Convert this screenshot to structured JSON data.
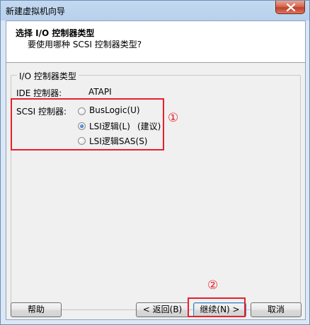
{
  "window": {
    "title": "新建虚拟机向导"
  },
  "header": {
    "title": "选择 I/O 控制器类型",
    "subtitle": "要使用哪种 SCSI 控制器类型?"
  },
  "group": {
    "legend": "I/O 控制器类型",
    "ide_label": "IDE 控制器:",
    "ide_value": "ATAPI",
    "scsi_label": "SCSI 控制器:",
    "options": [
      {
        "label": "BusLogic(U)",
        "checked": false
      },
      {
        "label": "LSI逻辑(L)",
        "checked": true,
        "note": "(建议)"
      },
      {
        "label": "LSI逻辑SAS(S)",
        "checked": false
      }
    ]
  },
  "annotations": {
    "mark1": "①",
    "mark2": "②"
  },
  "buttons": {
    "help": "帮助",
    "back": "< 返回(B)",
    "next": "继续(N) >",
    "cancel": "取消"
  },
  "colors": {
    "annotation_red": "#e8202a",
    "header_bg": "#ffffff",
    "dialog_bg": "#f0f0f0"
  }
}
